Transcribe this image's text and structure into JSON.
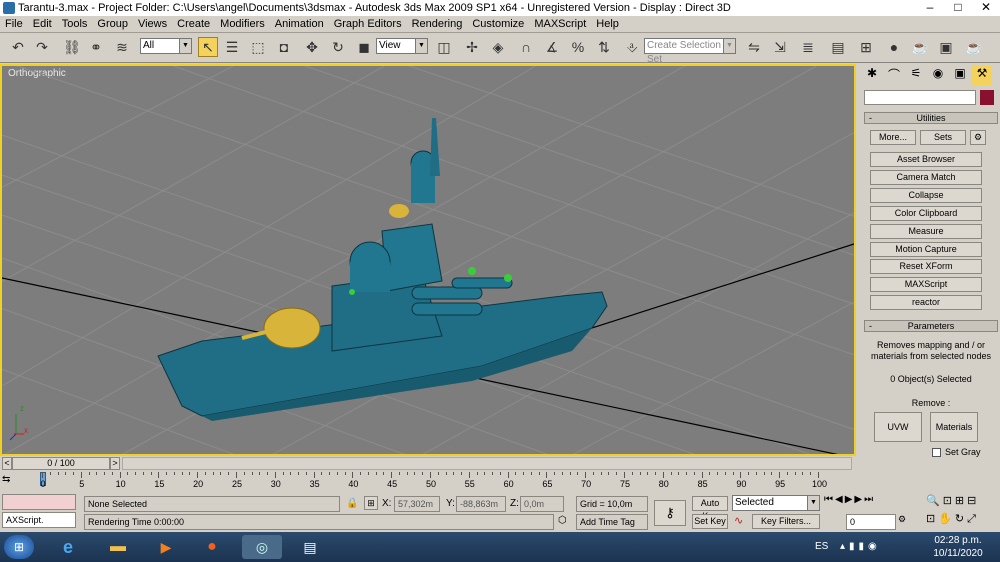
{
  "window": {
    "title": "Tarantu-3.max    - Project Folder: C:\\Users\\angel\\Documents\\3dsmax    - Autodesk 3ds Max  2009 SP1  x64    - Unregistered Version    - Display : Direct 3D",
    "minimize": "–",
    "maximize": "□",
    "close": "✕"
  },
  "menu": [
    "File",
    "Edit",
    "Tools",
    "Group",
    "Views",
    "Create",
    "Modifiers",
    "Animation",
    "Graph Editors",
    "Rendering",
    "Customize",
    "MAXScript",
    "Help"
  ],
  "toolbar": {
    "filter_value": "All",
    "ref_coord_value": "View",
    "selection_set_placeholder": "Create Selection Set"
  },
  "viewport": {
    "label": "Orthographic",
    "axis_x": "x",
    "axis_y": "y",
    "axis_z": "z"
  },
  "command_panel": {
    "utilities_header": "Utilities",
    "more_label": "More...",
    "sets_label": "Sets",
    "utility_buttons": [
      "Asset Browser",
      "Camera Match",
      "Collapse",
      "Color Clipboard",
      "Measure",
      "Motion Capture",
      "Reset XForm",
      "MAXScript",
      "reactor"
    ],
    "parameters_header": "Parameters",
    "description": "Removes mapping and / or materials from selected nodes",
    "selected_count": "0 Object(s) Selected",
    "remove_label": "Remove :",
    "uvw_label": "UVW",
    "materials_label": "Materials",
    "set_gray_label": "Set Gray",
    "collapse_symbol": "-"
  },
  "timeline": {
    "position": "0 / 100",
    "prev": "<",
    "next": ">"
  },
  "trackbar": {
    "ticks": [
      "0",
      "5",
      "10",
      "15",
      "20",
      "25",
      "30",
      "35",
      "40",
      "45",
      "50",
      "55",
      "60",
      "65",
      "70",
      "75",
      "80",
      "85",
      "90",
      "95",
      "100"
    ]
  },
  "status": {
    "maxscript_label": "AXScript.",
    "selection_status": "None Selected",
    "rendering_time": "Rendering Time  0:00:00",
    "x_label": "X:",
    "x_value": "57,302m",
    "y_label": "Y:",
    "y_value": "-88,863m",
    "z_label": "Z:",
    "z_value": "0,0m",
    "grid": "Grid = 10,0m",
    "add_time_tag": "Add Time Tag",
    "auto_key": "Auto Key",
    "set_key": "Set Key",
    "key_mode_value": "Selected",
    "key_filters": "Key Filters...",
    "frame_value": "0"
  },
  "taskbar": {
    "lang": "ES",
    "time": "02:28 p.m.",
    "date": "10/11/2020"
  },
  "colors": {
    "accent": "#f0d020",
    "viewport_bg": "#7d7d7d",
    "ship": "#1f6e86",
    "gun": "#d9b43a"
  }
}
